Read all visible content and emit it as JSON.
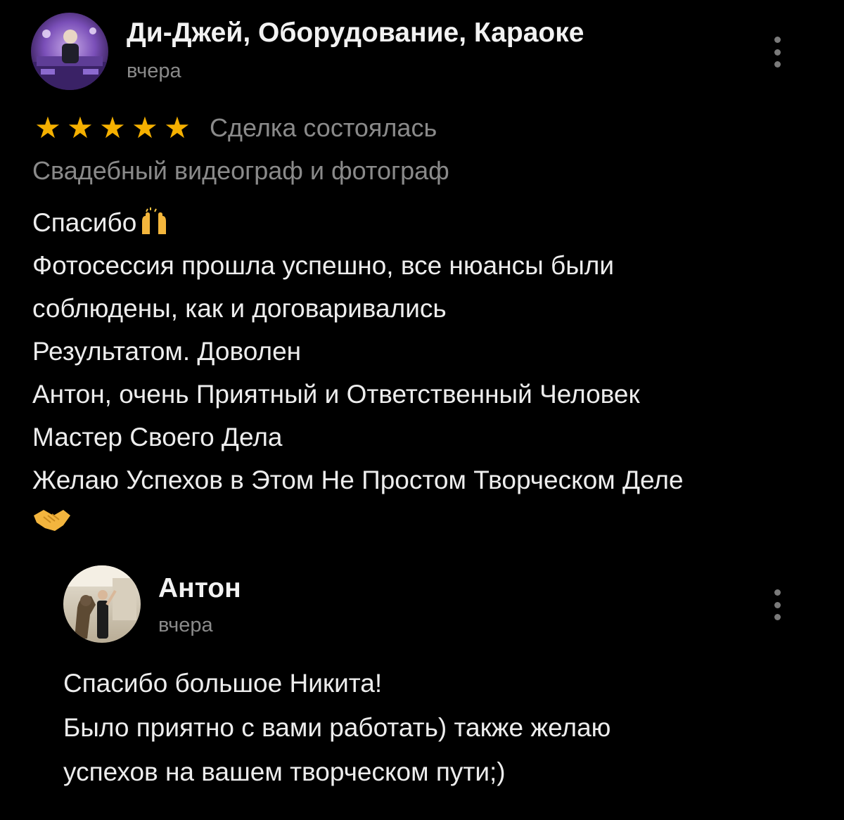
{
  "review": {
    "author": "Ди-Джей, Оборудование, Караоке",
    "date": "вчера",
    "rating": 5,
    "rating_max": 5,
    "deal_status": "Сделка состоялась",
    "service": "Свадебный видеограф и фотограф",
    "text_lines": [
      "Спасибо",
      "Фотосессия прошла успешно, все нюансы были",
      "соблюдены, как и договаривались",
      "Результатом. Доволен",
      "Антон, очень Приятный и Ответственный Человек",
      "Мастер Своего Дела",
      "Желаю Успехов в Этом Не Простом  Творческом Деле"
    ],
    "star_color": "#f5b000"
  },
  "reply": {
    "author": "Антон",
    "date": "вчера",
    "text_lines": [
      "Спасибо большое Никита!",
      "Было приятно с вами работать) также желаю",
      "успехов на вашем творческом пути;)"
    ]
  },
  "icons": {
    "more": "more-vertical-icon",
    "star": "star-icon",
    "raised_hands": "raising-hands-emoji",
    "handshake": "handshake-emoji"
  }
}
